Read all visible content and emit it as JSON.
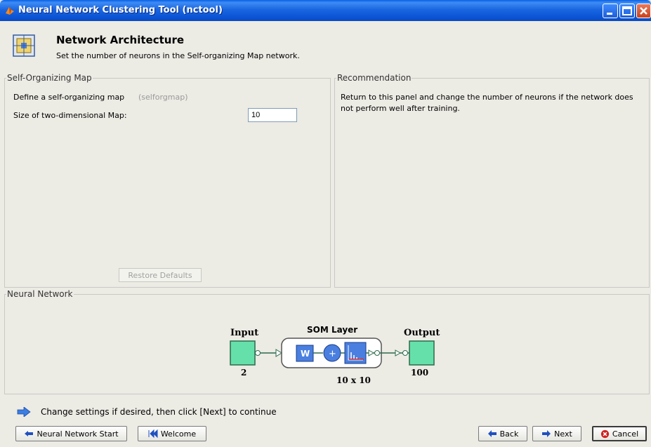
{
  "window": {
    "title": "Neural Network Clustering Tool (nctool)"
  },
  "header": {
    "title": "Network Architecture",
    "description": "Set the number of neurons in the Self-organizing Map network."
  },
  "som_panel": {
    "legend": "Self-Organizing Map",
    "define_label": "Define a self-organizing map",
    "define_function": "(selforgmap)",
    "size_label": "Size of two-dimensional Map:",
    "size_value": "10",
    "restore_button": "Restore Defaults"
  },
  "recommendation_panel": {
    "legend": "Recommendation",
    "text_line1": "Return to this panel and change the number of neurons if the network does",
    "text_line2": "not perform well after training."
  },
  "network_panel": {
    "legend": "Neural Network",
    "input_label": "Input",
    "input_size": "2",
    "layer_label": "SOM Layer",
    "weight_label": "W",
    "sum_label": "+",
    "layer_size": "10 x 10",
    "output_label": "Output",
    "output_size": "100"
  },
  "footer": {
    "hint": "Change settings  if desired, then click [Next] to continue",
    "start_button": "Neural Network Start",
    "welcome_button": "Welcome",
    "back_button": "Back",
    "next_button": "Next",
    "cancel_button": "Cancel"
  },
  "icons": {
    "app": "matlab-icon",
    "header": "network-architecture-icon",
    "hint": "blue-arrow-icon",
    "start": "neural-network-start-icon",
    "welcome": "welcome-icon",
    "back": "back-arrow-icon",
    "next": "next-arrow-icon",
    "cancel": "cancel-icon"
  },
  "colors": {
    "title_bar": "#0b55d6",
    "diagram_node": "#66e0aa",
    "diagram_box": "#4a7fe0"
  }
}
